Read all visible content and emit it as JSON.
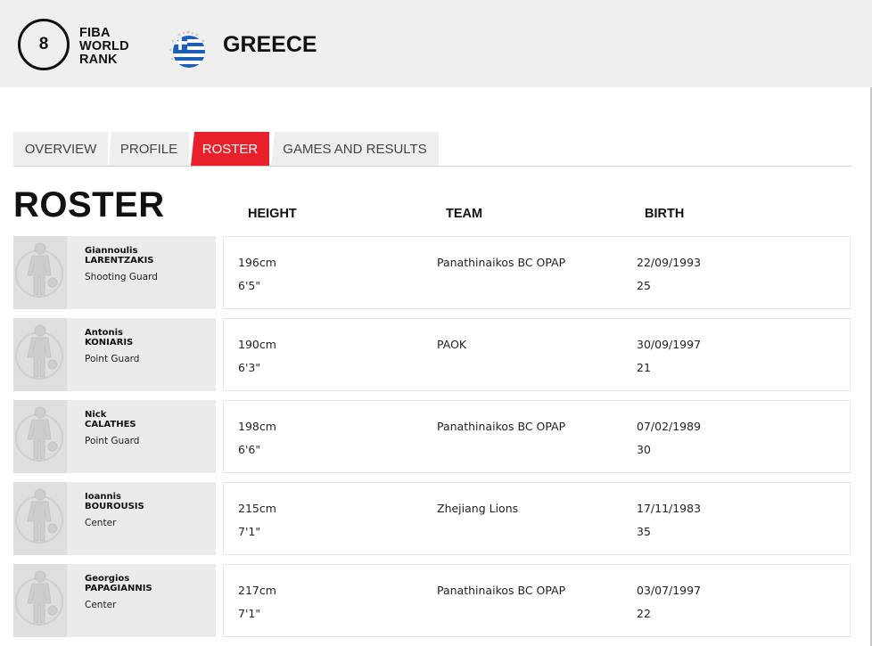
{
  "header": {
    "rank": "8",
    "rank_label": [
      "FIBA",
      "WORLD",
      "RANK"
    ],
    "country": "GREECE",
    "flag_colors": {
      "blue": "#1d5fb8",
      "white": "#ffffff"
    },
    "flag_icon": "greece-flag-icon"
  },
  "tabs": [
    {
      "label": "OVERVIEW",
      "active": false
    },
    {
      "label": "PROFILE",
      "active": false
    },
    {
      "label": "ROSTER",
      "active": true
    },
    {
      "label": "GAMES AND RESULTS",
      "active": false
    }
  ],
  "accent_color": "#e8202c",
  "roster": {
    "title": "ROSTER",
    "columns": [
      "HEIGHT",
      "TEAM",
      "BIRTH"
    ],
    "players": [
      {
        "first": "Giannoulis",
        "last": "LARENTZAKIS",
        "position": "Shooting Guard",
        "height_cm": "196cm",
        "height_ft": "6'5\"",
        "team": "Panathinaikos BC OPAP",
        "birth": "22/09/1993",
        "age": "25"
      },
      {
        "first": "Antonis",
        "last": "KONIARIS",
        "position": "Point Guard",
        "height_cm": "190cm",
        "height_ft": "6'3\"",
        "team": "PAOK",
        "birth": "30/09/1997",
        "age": "21"
      },
      {
        "first": "Nick",
        "last": "CALATHES",
        "position": "Point Guard",
        "height_cm": "198cm",
        "height_ft": "6'6\"",
        "team": "Panathinaikos BC OPAP",
        "birth": "07/02/1989",
        "age": "30"
      },
      {
        "first": "Ioannis",
        "last": "BOUROUSIS",
        "position": "Center",
        "height_cm": "215cm",
        "height_ft": "7'1\"",
        "team": "Zhejiang Lions",
        "birth": "17/11/1983",
        "age": "35"
      },
      {
        "first": "Georgios",
        "last": "PAPAGIANNIS",
        "position": "Center",
        "height_cm": "217cm",
        "height_ft": "7'1\"",
        "team": "Panathinaikos BC OPAP",
        "birth": "03/07/1997",
        "age": "22"
      }
    ]
  }
}
